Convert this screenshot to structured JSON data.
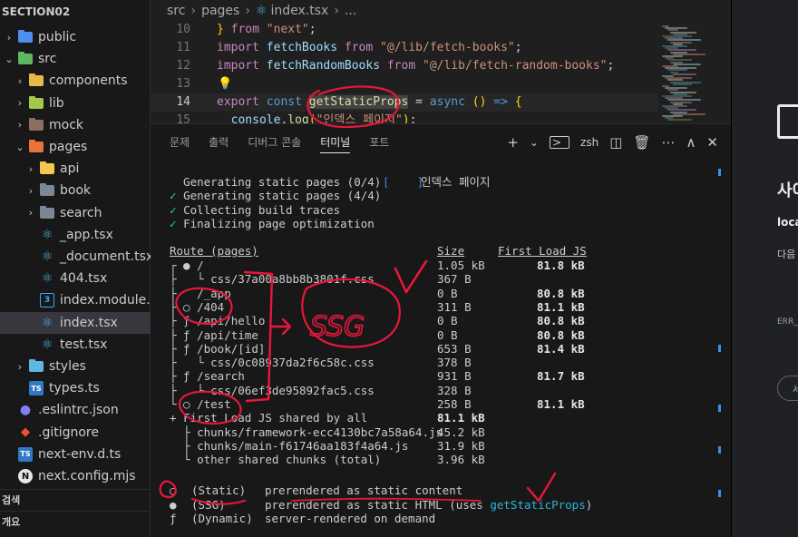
{
  "sidebar": {
    "section_title": "SECTION02",
    "items": [
      {
        "label": "public",
        "kind": "folder",
        "chevron": "›",
        "icon": "globe-folder-icon",
        "color": "#4f8ff0"
      },
      {
        "label": "src",
        "kind": "folder",
        "chevron": "⌄",
        "icon": "src-folder-icon",
        "color": "#5fb761"
      },
      {
        "label": "components",
        "kind": "folder",
        "chevron": "›",
        "icon": "components-folder-icon",
        "color": "#e6b94a"
      },
      {
        "label": "lib",
        "kind": "folder",
        "chevron": "›",
        "icon": "lib-folder-icon",
        "color": "#a5c84a"
      },
      {
        "label": "mock",
        "kind": "folder",
        "chevron": "›",
        "icon": "mock-folder-icon",
        "color": "#8d6e63"
      },
      {
        "label": "pages",
        "kind": "folder",
        "chevron": "⌄",
        "icon": "pages-folder-icon",
        "color": "#e8743b"
      },
      {
        "label": "api",
        "kind": "folder",
        "chevron": "›",
        "icon": "api-folder-icon",
        "color": "#f2c94c"
      },
      {
        "label": "book",
        "kind": "folder",
        "chevron": "›",
        "icon": "folder-icon",
        "color": "#7b8794"
      },
      {
        "label": "search",
        "kind": "folder",
        "chevron": "›",
        "icon": "folder-icon",
        "color": "#7b8794"
      },
      {
        "label": "_app.tsx",
        "kind": "react",
        "icon": "react-icon"
      },
      {
        "label": "_document.tsx",
        "kind": "react",
        "icon": "react-icon"
      },
      {
        "label": "404.tsx",
        "kind": "react",
        "icon": "react-icon"
      },
      {
        "label": "index.module.…",
        "kind": "css",
        "icon": "css-icon"
      },
      {
        "label": "index.tsx",
        "kind": "react",
        "icon": "react-icon",
        "selected": true
      },
      {
        "label": "test.tsx",
        "kind": "react",
        "icon": "react-icon"
      },
      {
        "label": "styles",
        "kind": "folder",
        "chevron": "›",
        "icon": "styles-folder-icon",
        "color": "#5fb7e0"
      },
      {
        "label": "types.ts",
        "kind": "ts",
        "icon": "typescript-icon"
      },
      {
        "label": ".eslintrc.json",
        "kind": "eslint",
        "icon": "eslint-icon"
      },
      {
        "label": ".gitignore",
        "kind": "git",
        "icon": "git-icon"
      },
      {
        "label": "next-env.d.ts",
        "kind": "ts",
        "icon": "typescript-icon"
      },
      {
        "label": "next.config.mjs",
        "kind": "next",
        "icon": "next-icon"
      }
    ],
    "bottom_sections": [
      "검색",
      "개요"
    ]
  },
  "breadcrumb": [
    "src",
    "pages",
    "index.tsx",
    "..."
  ],
  "editor": {
    "lines": [
      {
        "n": "10",
        "tokens": [
          [
            "brk",
            "} "
          ],
          [
            "kw",
            "from"
          ],
          [
            "pun",
            " "
          ],
          [
            "str",
            "\"next\""
          ],
          [
            "pun",
            ";"
          ]
        ]
      },
      {
        "n": "11",
        "tokens": [
          [
            "kw",
            "import"
          ],
          [
            "pun",
            " "
          ],
          [
            "var",
            "fetchBooks"
          ],
          [
            "pun",
            " "
          ],
          [
            "kw",
            "from"
          ],
          [
            "pun",
            " "
          ],
          [
            "str",
            "\"@/lib/fetch-books\""
          ],
          [
            "pun",
            ";"
          ]
        ]
      },
      {
        "n": "12",
        "tokens": [
          [
            "kw",
            "import"
          ],
          [
            "pun",
            " "
          ],
          [
            "var",
            "fetchRandomBooks"
          ],
          [
            "pun",
            " "
          ],
          [
            "kw",
            "from"
          ],
          [
            "pun",
            " "
          ],
          [
            "str",
            "\"@/lib/fetch-random-books\""
          ],
          [
            "pun",
            ";"
          ]
        ]
      },
      {
        "n": "13",
        "tokens": []
      },
      {
        "n": "14",
        "tokens": [
          [
            "kw",
            "export"
          ],
          [
            "pun",
            " "
          ],
          [
            "kw2",
            "const"
          ],
          [
            "pun",
            " "
          ],
          [
            "fn",
            "getStaticProps"
          ],
          [
            "pun",
            " = "
          ],
          [
            "kw2",
            "async"
          ],
          [
            "pun",
            " "
          ],
          [
            "brk",
            "()"
          ],
          [
            "pun",
            " "
          ],
          [
            "kw2",
            "=>"
          ],
          [
            "pun",
            " "
          ],
          [
            "brk",
            "{"
          ]
        ]
      },
      {
        "n": "15",
        "tokens": [
          [
            "pun",
            "  "
          ],
          [
            "var",
            "console"
          ],
          [
            "pun",
            "."
          ],
          [
            "fn",
            "log"
          ],
          [
            "brk",
            "("
          ],
          [
            "str",
            "\"인덱스 페이지\""
          ],
          [
            "brk",
            ")"
          ],
          [
            "pun",
            ";"
          ]
        ]
      }
    ]
  },
  "panel": {
    "tabs": [
      "문제",
      "출력",
      "디버그 콘솔",
      "터미널",
      "포트"
    ],
    "active_tab": "터미널",
    "shell": "zsh"
  },
  "terminal": {
    "build": [
      "Generating static pages (0/4)",
      "Generating static pages (4/4)",
      "Collecting build traces",
      "Finalizing page optimization"
    ],
    "build_log_bracket": "[    ]",
    "build_log_text": "인덱스 페이지",
    "header": {
      "route": "Route (pages)",
      "size": "Size",
      "first_load": "First Load JS"
    },
    "routes": [
      {
        "prefix": "┌ ● ",
        "path": "/",
        "size": "1.05 kB",
        "first": "81.8 kB"
      },
      {
        "prefix": "├   └ ",
        "path": "css/37a00a8bb8b3801f.css",
        "size": "367 B",
        "first": ""
      },
      {
        "prefix": "├   ",
        "path": "/_app",
        "size": "0 B",
        "first": "80.8 kB"
      },
      {
        "prefix": "├ ○ ",
        "path": "/404",
        "size": "311 B",
        "first": "81.1 kB"
      },
      {
        "prefix": "├ ƒ ",
        "path": "/api/hello",
        "size": "0 B",
        "first": "80.8 kB"
      },
      {
        "prefix": "├ ƒ ",
        "path": "/api/time",
        "size": "0 B",
        "first": "80.8 kB"
      },
      {
        "prefix": "├ ƒ ",
        "path": "/book/[id]",
        "size": "653 B",
        "first": "81.4 kB"
      },
      {
        "prefix": "├   └ ",
        "path": "css/0c08937da2f6c58c.css",
        "size": "378 B",
        "first": ""
      },
      {
        "prefix": "├ ƒ ",
        "path": "/search",
        "size": "931 B",
        "first": "81.7 kB"
      },
      {
        "prefix": "├   └ ",
        "path": "css/06ef3de95892fac5.css",
        "size": "328 B",
        "first": ""
      },
      {
        "prefix": "└ ○ ",
        "path": "/test",
        "size": "258 B",
        "first": "81.1 kB"
      }
    ],
    "shared": {
      "prefix": "+ ",
      "label": "First Load JS shared by all",
      "size": "81.1 kB"
    },
    "chunks": [
      {
        "prefix": "  ├ ",
        "name": "chunks/framework-ecc4130bc7a58a64.js",
        "size": "45.2 kB"
      },
      {
        "prefix": "  ├ ",
        "name": "chunks/main-f61746aa183f4a64.js",
        "size": "31.9 kB"
      },
      {
        "prefix": "  └ ",
        "name": "other shared chunks (total)",
        "size": "3.96 kB"
      }
    ],
    "legend": [
      {
        "sym": "○",
        "name": "(Static)",
        "desc": "prerendered as static content"
      },
      {
        "sym": "●",
        "name": "(SSG)",
        "desc": "prerendered as static HTML (uses ",
        "link": "getStaticProps",
        "tail": ")"
      },
      {
        "sym": "ƒ",
        "name": "(Dynamic)",
        "desc": "server-rendered on demand"
      }
    ]
  },
  "browser": {
    "lines": [
      "사이",
      "loca",
      "다음",
      "ERR_",
      "세"
    ]
  },
  "annotation": {
    "handwritten_label": "SSG",
    "ink_color": "#e8173a"
  }
}
